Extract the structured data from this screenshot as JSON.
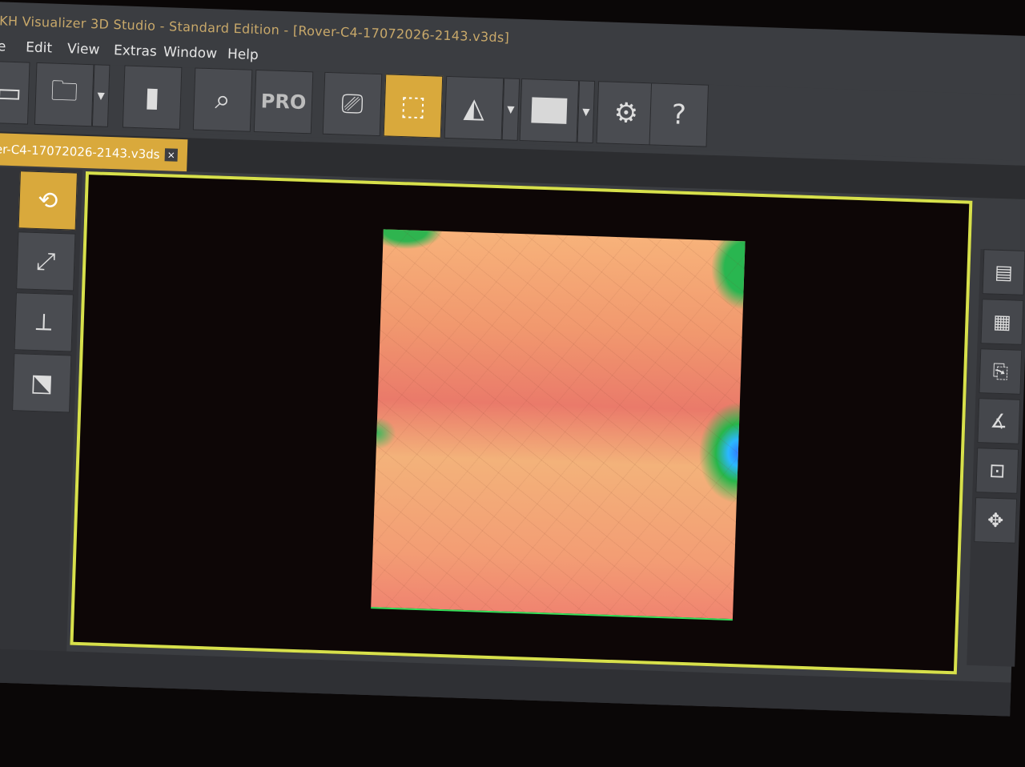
{
  "window": {
    "title": "KH Visualizer 3D Studio - Standard Edition - [Rover-C4-17072026-2143.v3ds]"
  },
  "menu": {
    "items": [
      "le",
      "Edit",
      "View",
      "Extras",
      "Window",
      "Help"
    ]
  },
  "toolbar": {
    "pro_label": "PRO",
    "buttons": [
      {
        "icon": "monitor-icon"
      },
      {
        "icon": "folder-open-icon"
      },
      {
        "icon": "sd-card-icon"
      },
      {
        "icon": "report-search-icon"
      },
      {
        "icon": "pro-badge-icon"
      },
      {
        "icon": "screen-capture-icon"
      },
      {
        "icon": "3d-cube-view-icon",
        "active": true
      },
      {
        "icon": "terrain-mesh-icon"
      },
      {
        "icon": "color-swatch-icon"
      },
      {
        "icon": "gear-icon"
      },
      {
        "icon": "help-icon"
      }
    ]
  },
  "document_tab": {
    "label": "er-C4-17072026-2143.v3ds",
    "close_label": "×"
  },
  "colors": {
    "accent": "#d9a93c",
    "viewport_border": "#d7e04b",
    "toolbar_bg": "#3b3d41"
  }
}
